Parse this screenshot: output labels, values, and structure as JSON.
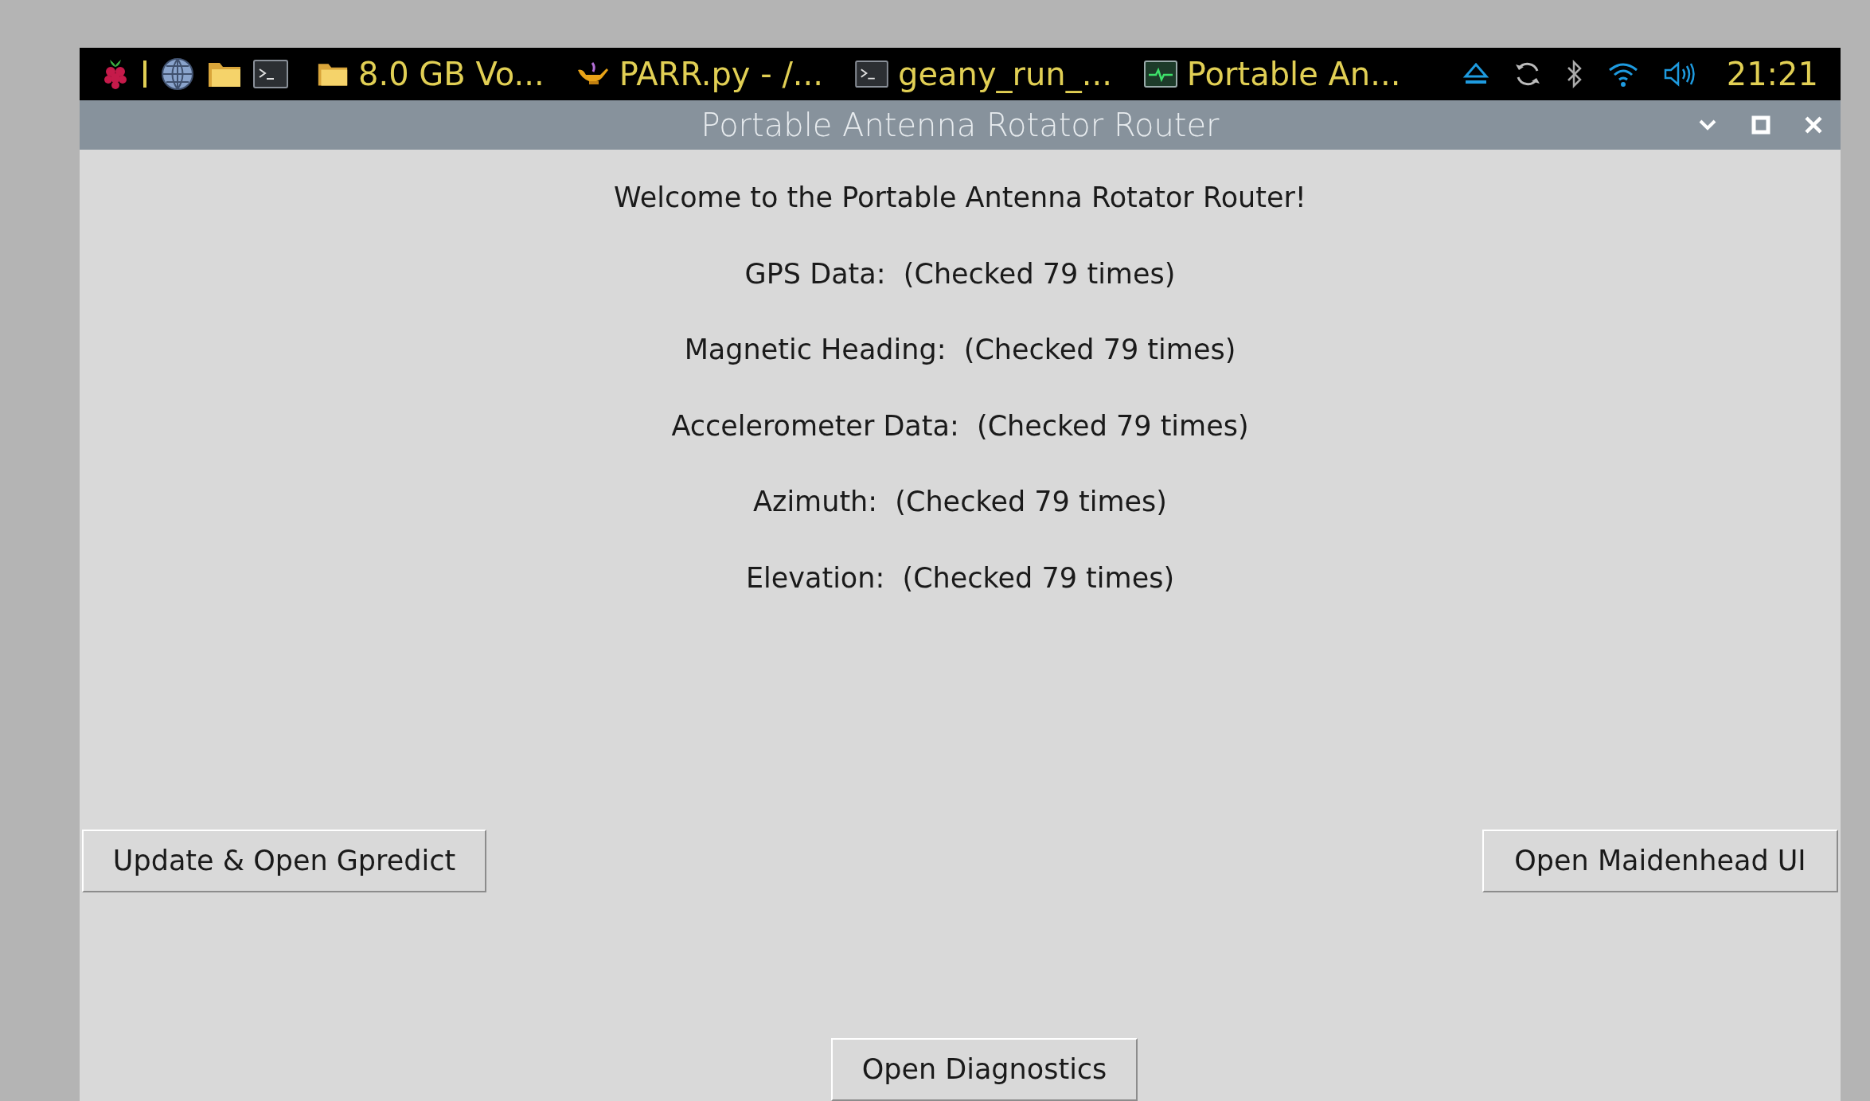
{
  "taskbar": {
    "tasks": [
      {
        "kind": "folder",
        "label": "8.0 GB Vo..."
      },
      {
        "kind": "lamp",
        "label": "PARR.py - /..."
      },
      {
        "kind": "terminal",
        "label": "geany_run_..."
      },
      {
        "kind": "monitor",
        "label": "Portable An..."
      }
    ],
    "clock": "21:21"
  },
  "window": {
    "title": "Portable Antenna Rotator Router"
  },
  "welcome": "Welcome to the Portable Antenna Rotator Router!",
  "readings": [
    "GPS Data:  (Checked 79 times)",
    "Magnetic Heading:  (Checked 79 times)",
    "Accelerometer Data:  (Checked 79 times)",
    "Azimuth:  (Checked 79 times)",
    "Elevation:  (Checked 79 times)"
  ],
  "buttons": {
    "left": "Update & Open Gpredict",
    "right": "Open Maidenhead UI",
    "bottom": "Open Diagnostics"
  }
}
